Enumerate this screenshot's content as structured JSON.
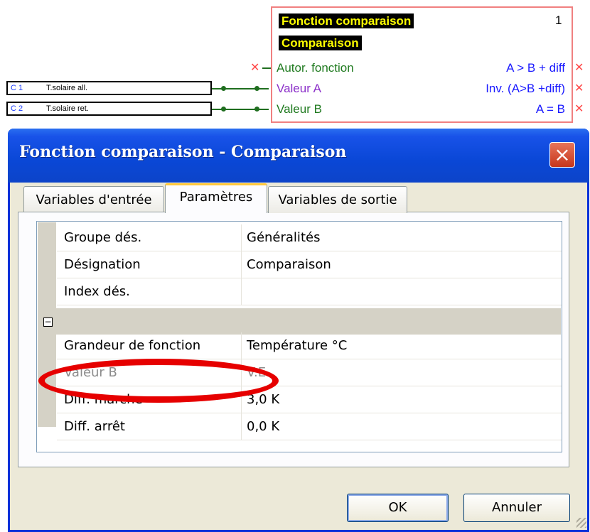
{
  "block": {
    "title_label": "Fonction comparaison",
    "subtitle_label": "Comparaison",
    "number": "1",
    "inputs": [
      "Autor. fonction",
      "Valeur A",
      "Valeur B"
    ],
    "outputs": [
      "A > B + diff",
      "Inv. (A>B +diff)",
      "A = B"
    ]
  },
  "sources": [
    {
      "num": "C 1",
      "label": "T.solaire all."
    },
    {
      "num": "C 2",
      "label": "T.solaire ret."
    }
  ],
  "dialog": {
    "title": "Fonction comparaison - Comparaison",
    "close_icon": "×",
    "tabs": [
      "Variables d'entrée",
      "Paramètres",
      "Variables de sortie"
    ],
    "active_tab": "Paramètres",
    "rows": [
      {
        "name": "Groupe dés.",
        "value": "Généralités"
      },
      {
        "name": "Désignation",
        "value": "Comparaison"
      },
      {
        "name": "Index dés.",
        "value": ""
      },
      {
        "name": "Grandeur de fonction",
        "value": "Température °C"
      },
      {
        "name": "Valeur B",
        "value": "V.E."
      },
      {
        "name": "Diff. marche",
        "value": "3,0 K"
      },
      {
        "name": "Diff. arrêt",
        "value": "0,0 K"
      }
    ],
    "expander_symbol": "−",
    "ok_label": "OK",
    "cancel_label": "Annuler"
  },
  "colors": {
    "input_purple": "#8b2fc9",
    "input_green": "#1f7a1f",
    "output_blue": "#1a1aff",
    "highlight_red": "#e60000"
  }
}
